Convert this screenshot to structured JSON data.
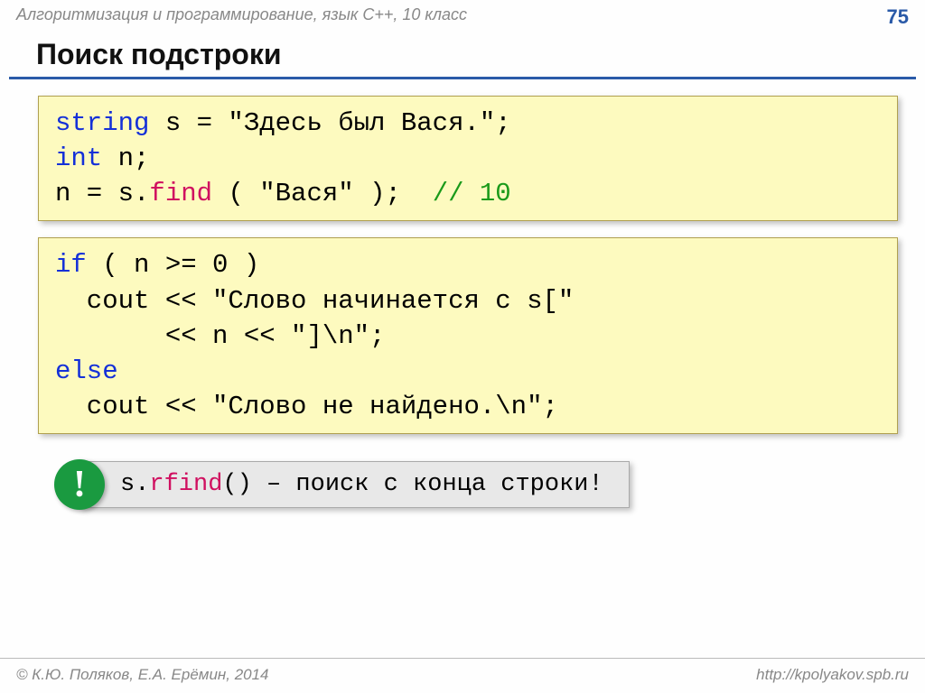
{
  "header": {
    "course": "Алгоритмизация и программирование, язык C++, 10 класс",
    "page": "75"
  },
  "title": "Поиск подстроки",
  "code1": {
    "kw1": "string",
    "t1": " s = \"Здесь был Вася.\";",
    "kw2": "int",
    "t2": " n;",
    "t3": "n = s.",
    "fn1": "find",
    "t4": " ( \"Вася\" );  ",
    "cmt": "// 10"
  },
  "code2": {
    "kw1": "if",
    "t1": " ( n >= 0 )",
    "t2": "  cout << \"Слово начинается с s[\"",
    "t3": "       << n << \"]\\n\";",
    "kw2": "else",
    "t4": "  cout << \"Слово не найдено.\\n\";"
  },
  "note": {
    "bang": "!",
    "pre": " s.",
    "fn": "rfind",
    "post": "() – поиск с конца строки!"
  },
  "footer": {
    "left": "© К.Ю. Поляков, Е.А. Ерёмин, 2014",
    "right": "http://kpolyakov.spb.ru"
  }
}
